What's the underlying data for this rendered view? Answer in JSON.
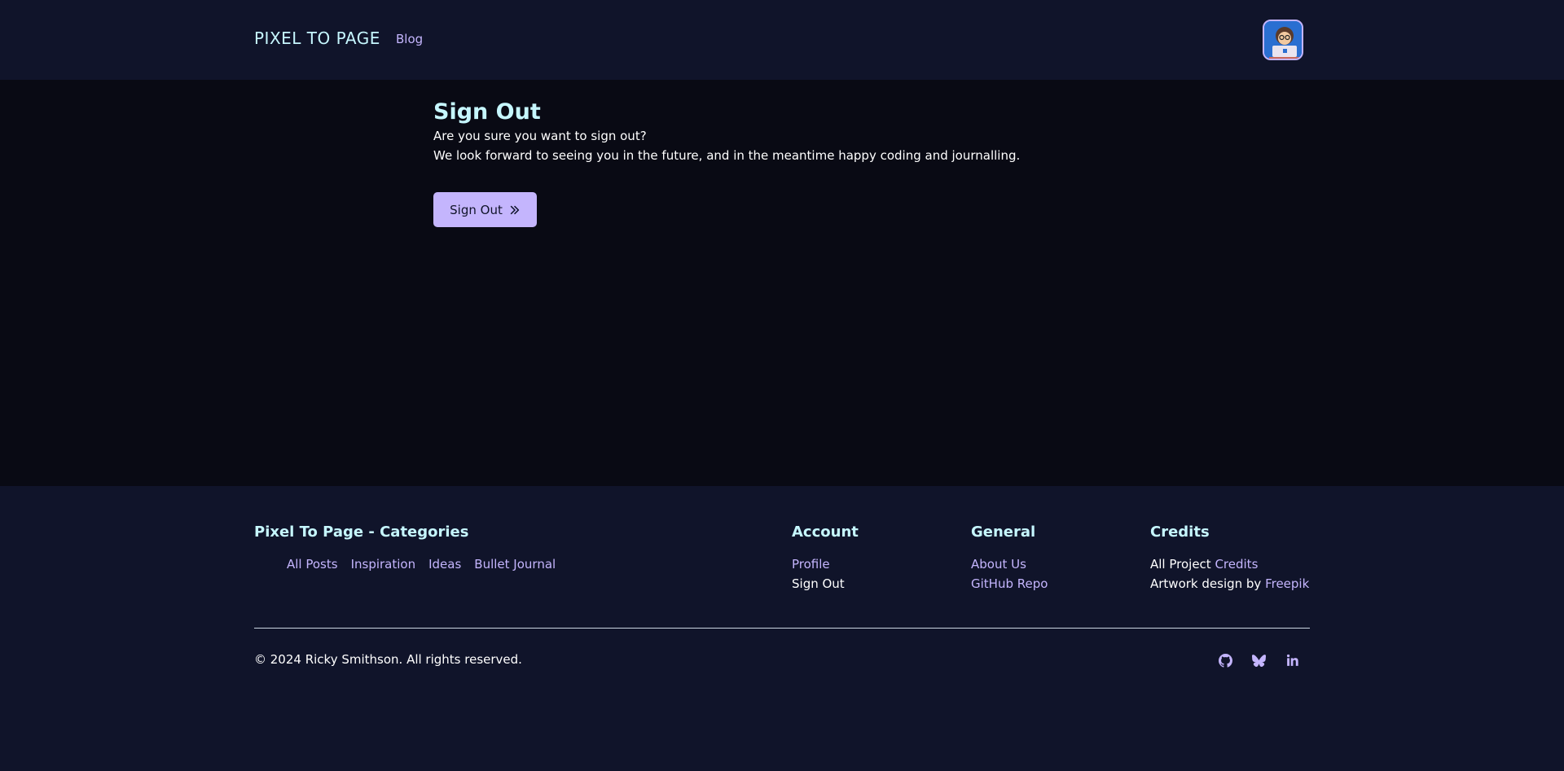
{
  "header": {
    "brand": "PIXEL TO PAGE",
    "nav": {
      "blog": "Blog"
    },
    "avatar": "avatar"
  },
  "main": {
    "title": "Sign Out",
    "line1": "Are you sure you want to sign out?",
    "line2": "We look forward to seeing you in the future, and in the meantime happy coding and journalling.",
    "button_label": "Sign Out",
    "button_icon": "double-chevron-right-icon"
  },
  "footer": {
    "categories": {
      "heading": "Pixel To Page - Categories",
      "links": [
        "All Posts",
        "Inspiration",
        "Ideas",
        "Bullet Journal"
      ]
    },
    "account": {
      "heading": "Account",
      "profile": "Profile",
      "signout": "Sign Out"
    },
    "general": {
      "heading": "General",
      "about": "About Us",
      "github": "GitHub Repo"
    },
    "credits": {
      "heading": "Credits",
      "line1_prefix": "All Project ",
      "line1_link": "Credits",
      "line2_prefix": "Artwork design by ",
      "line2_link": "Freepik"
    },
    "copyright": "© 2024 Ricky Smithson. All rights reserved.",
    "socials": [
      "github-icon",
      "bluesky-icon",
      "linkedin-icon"
    ]
  },
  "colors": {
    "accent": "#c4b5fd",
    "heading": "#c6f7ff",
    "header_bg": "#10142a",
    "main_bg": "#090a14"
  }
}
